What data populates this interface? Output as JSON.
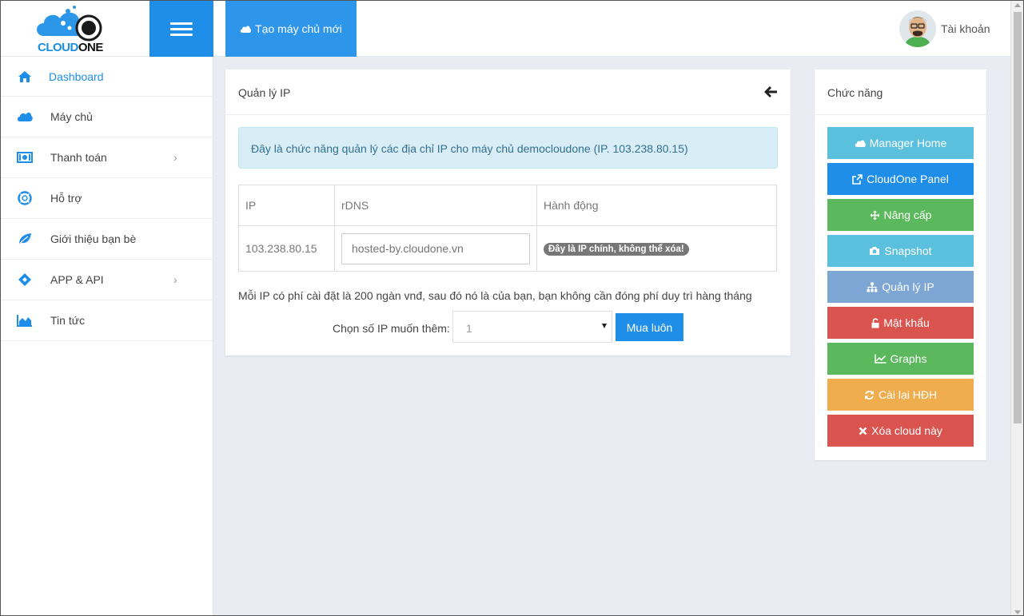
{
  "header": {
    "logo": {
      "text_main": "CLOUD",
      "text_bold": "ONE"
    },
    "new_server_label": "Tạo máy chủ mới",
    "account_label": "Tài khoản"
  },
  "sidebar": {
    "items": [
      {
        "label": "Dashboard",
        "icon": "home-icon",
        "active": true
      },
      {
        "label": "Máy chủ",
        "icon": "cloud-icon"
      },
      {
        "label": "Thanh toán",
        "icon": "money-icon",
        "has_submenu": true
      },
      {
        "label": "Hỗ trợ",
        "icon": "lifebuoy-icon"
      },
      {
        "label": "Giới thiệu bạn bè",
        "icon": "leaf-icon"
      },
      {
        "label": "APP & API",
        "icon": "ticket-icon",
        "has_submenu": true
      },
      {
        "label": "Tin tức",
        "icon": "area-chart-icon"
      }
    ]
  },
  "ip_panel": {
    "title": "Quản lý IP",
    "notice": "Đây là chức năng quản lý các địa chỉ IP cho máy chủ democloudone (IP. 103.238.80.15)",
    "table": {
      "headers": [
        "IP",
        "rDNS",
        "Hành động"
      ],
      "rows": [
        {
          "ip": "103.238.80.15",
          "rdns_placeholder": "hosted-by.cloudone.vn",
          "action_badge": "Đây là IP chính, không thể xóa!"
        }
      ]
    },
    "fee_note": "Mỗi IP có phí cài đặt là 200 ngàn vnđ, sau đó nó là của bạn, bạn không cần đóng phí duy trì hàng tháng",
    "buy_label": "Chọn số IP muốn thêm:",
    "quantity_selected": "1",
    "buy_button": "Mua luôn"
  },
  "functions": {
    "title": "Chức năng",
    "buttons": [
      {
        "label": "Manager Home",
        "icon": "cloud-icon",
        "color": "#5bc0de"
      },
      {
        "label": "CloudOne Panel",
        "icon": "external-link-icon",
        "color": "#1f8ee8"
      },
      {
        "label": "Nâng cấp",
        "icon": "arrows-icon",
        "color": "#5cb85c"
      },
      {
        "label": "Snapshot",
        "icon": "camera-icon",
        "color": "#5bc0de"
      },
      {
        "label": "Quản lý IP",
        "icon": "sitemap-icon",
        "color": "#7ea6d4"
      },
      {
        "label": "Mật khẩu",
        "icon": "unlock-icon",
        "color": "#d9534f"
      },
      {
        "label": "Graphs",
        "icon": "line-chart-icon",
        "color": "#5cb85c"
      },
      {
        "label": "Cài lại HĐH",
        "icon": "refresh-icon",
        "color": "#f0ad4e"
      },
      {
        "label": "Xóa cloud này",
        "icon": "times-icon",
        "color": "#d9534f"
      }
    ]
  },
  "colors": {
    "primary": "#1f8ee8",
    "page_background": "#e9ecf3",
    "info_background": "#d9edf7",
    "info_text": "#31708f"
  }
}
